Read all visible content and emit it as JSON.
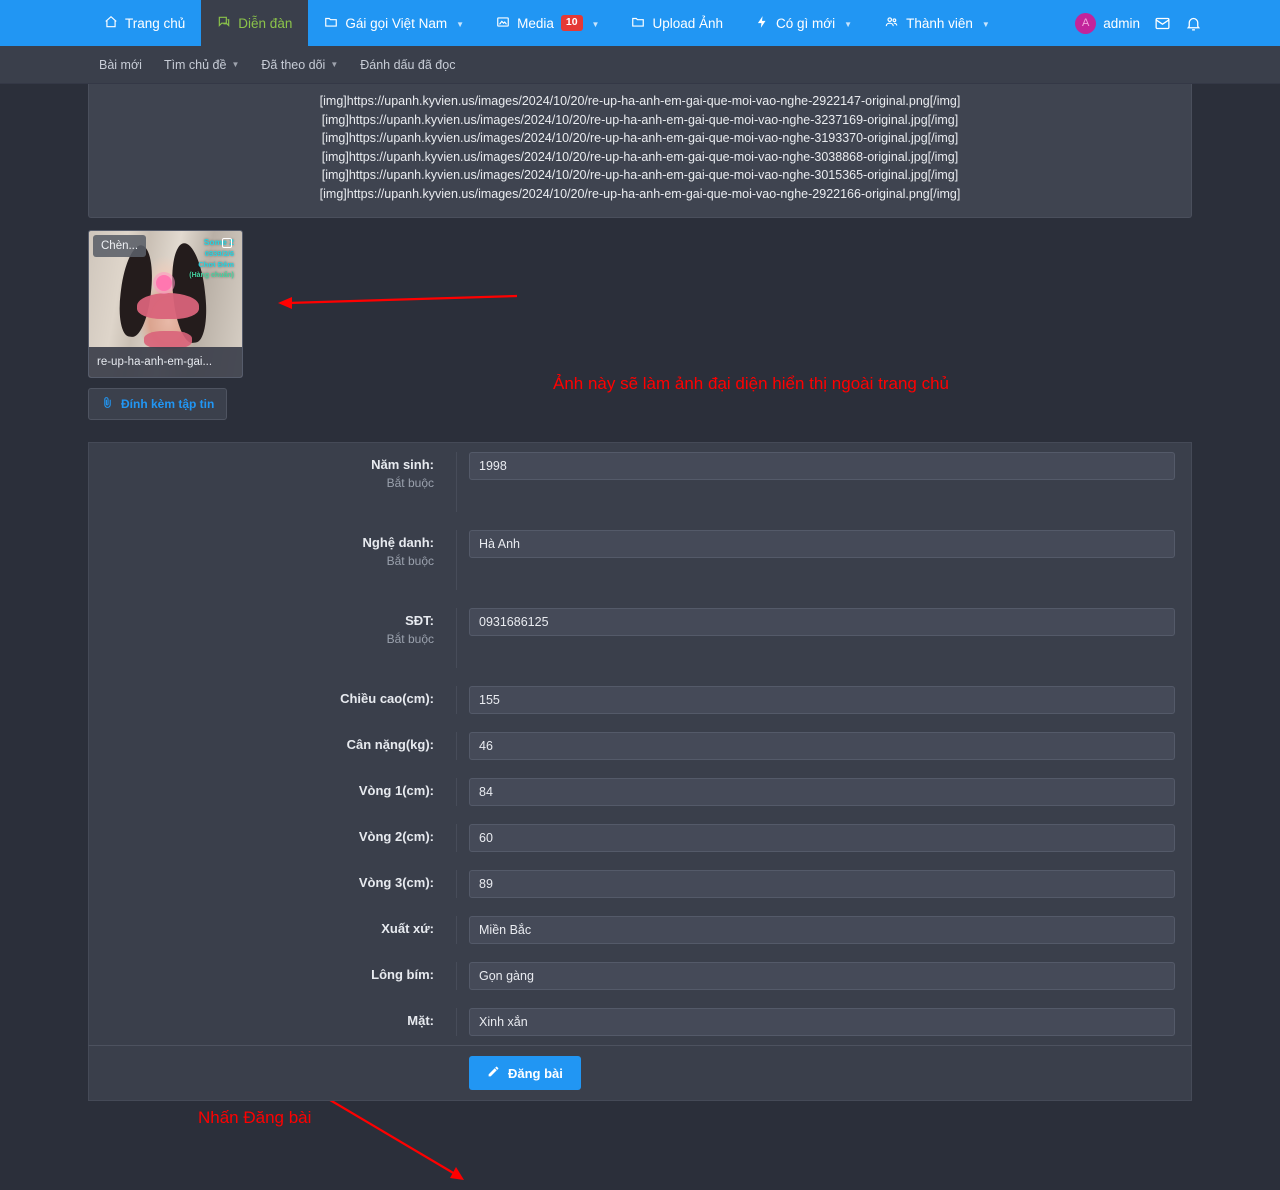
{
  "navbar": {
    "items": [
      {
        "label": "Trang chủ",
        "icon": "home-icon",
        "active": false,
        "caret": false
      },
      {
        "label": "Diễn đàn",
        "icon": "forum-icon",
        "active": true,
        "caret": false
      },
      {
        "label": "Gái gọi Việt Nam",
        "icon": "folder-icon",
        "active": false,
        "caret": true
      },
      {
        "label": "Media",
        "icon": "image-icon",
        "active": false,
        "caret": true,
        "badge": "10"
      },
      {
        "label": "Upload Ảnh",
        "icon": "folder-icon",
        "active": false,
        "caret": false
      },
      {
        "label": "Có gì mới",
        "icon": "bolt-icon",
        "active": false,
        "caret": true
      },
      {
        "label": "Thành viên",
        "icon": "people-icon",
        "active": false,
        "caret": true
      }
    ],
    "user": {
      "name": "admin",
      "avatar_initial": "A",
      "avatar_color": "#c2249b"
    },
    "accent_color": "#2196f3",
    "badge_color": "#e53935"
  },
  "subnav": {
    "items": [
      {
        "label": "Bài mới",
        "caret": false
      },
      {
        "label": "Tìm chủ đề",
        "caret": true
      },
      {
        "label": "Đã theo dõi",
        "caret": true
      },
      {
        "label": "Đánh dấu đã đọc",
        "caret": false
      }
    ]
  },
  "editor": {
    "bbcode_lines": [
      "[img]https://upanh.kyvien.us/images/2024/10/20/re-up-ha-anh-em-gai-que-moi-vao-nghe-2922147-original.png[/img]",
      "[img]https://upanh.kyvien.us/images/2024/10/20/re-up-ha-anh-em-gai-que-moi-vao-nghe-3237169-original.jpg[/img]",
      "[img]https://upanh.kyvien.us/images/2024/10/20/re-up-ha-anh-em-gai-que-moi-vao-nghe-3193370-original.jpg[/img]",
      "[img]https://upanh.kyvien.us/images/2024/10/20/re-up-ha-anh-em-gai-que-moi-vao-nghe-3038868-original.jpg[/img]",
      "[img]https://upanh.kyvien.us/images/2024/10/20/re-up-ha-anh-em-gai-que-moi-vao-nghe-3015365-original.jpg[/img]",
      "[img]https://upanh.kyvien.us/images/2024/10/20/re-up-ha-anh-em-gai-que-moi-vao-nghe-2922166-original.png[/img]"
    ]
  },
  "attachment": {
    "insert_label": "Chèn...",
    "filename": "re-up-ha-anh-em-gai...",
    "watermark_line1": "Some 2",
    "watermark_line2": "0939/2/6",
    "watermark_line3": "Chơi Đêm",
    "watermark_line4": "(Hàng chuẩn)",
    "attach_button_label": "Đính kèm tập tin"
  },
  "form": {
    "fields": [
      {
        "label": "Năm sinh:",
        "required_text": "Bắt buộc",
        "value": "1998"
      },
      {
        "label": "Nghệ danh:",
        "required_text": "Bắt buộc",
        "value": "Hà Anh"
      },
      {
        "label": "SĐT:",
        "required_text": "Bắt buộc",
        "value": "0931686125"
      },
      {
        "label": "Chiều cao(cm):",
        "required_text": "",
        "value": "155"
      },
      {
        "label": "Cân nặng(kg):",
        "required_text": "",
        "value": "46"
      },
      {
        "label": "Vòng 1(cm):",
        "required_text": "",
        "value": "84"
      },
      {
        "label": "Vòng 2(cm):",
        "required_text": "",
        "value": "60"
      },
      {
        "label": "Vòng 3(cm):",
        "required_text": "",
        "value": "89"
      },
      {
        "label": "Xuất xứ:",
        "required_text": "",
        "value": "Miền Bắc"
      },
      {
        "label": "Lông bím:",
        "required_text": "",
        "value": "Gọn gàng"
      },
      {
        "label": "Mặt:",
        "required_text": "",
        "value": "Xinh xắn"
      }
    ],
    "submit_label": "Đăng bài"
  },
  "annotations": {
    "color": "#ff0000",
    "avatar_note": "Ảnh này sẽ làm ảnh đại diện hiển thị ngoài trang chủ",
    "submit_note": "Nhấn Đăng bài"
  }
}
